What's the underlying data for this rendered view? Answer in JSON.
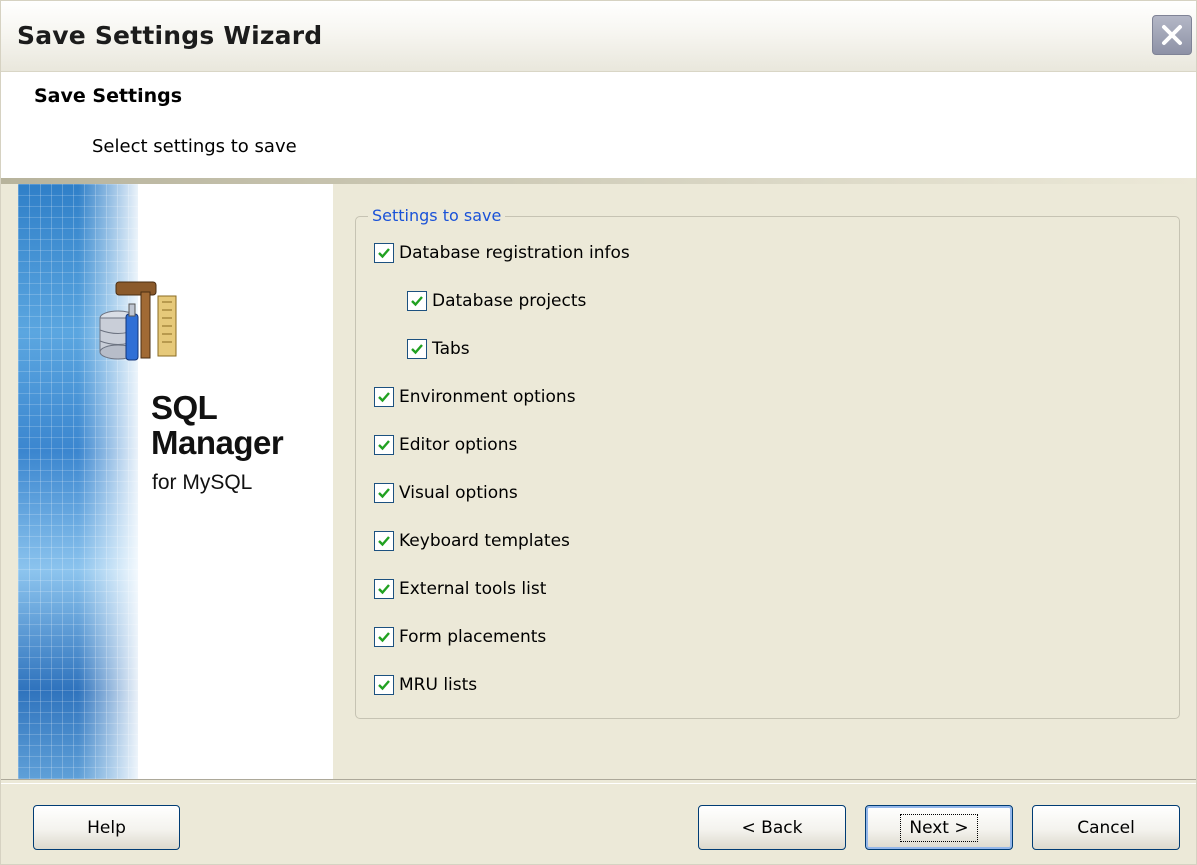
{
  "window": {
    "title": "Save Settings Wizard"
  },
  "header": {
    "title": "Save Settings",
    "subtitle": "Select settings to save"
  },
  "banner": {
    "product_line1": "SQL",
    "product_line2": "Manager",
    "product_line3": "for MySQL"
  },
  "group": {
    "legend": "Settings to save",
    "items": [
      {
        "label": "Database registration infos",
        "checked": true,
        "indent": 0
      },
      {
        "label": "Database projects",
        "checked": true,
        "indent": 1
      },
      {
        "label": "Tabs",
        "checked": true,
        "indent": 1
      },
      {
        "label": "Environment options",
        "checked": true,
        "indent": 0
      },
      {
        "label": "Editor options",
        "checked": true,
        "indent": 0
      },
      {
        "label": "Visual options",
        "checked": true,
        "indent": 0
      },
      {
        "label": "Keyboard templates",
        "checked": true,
        "indent": 0
      },
      {
        "label": "External tools list",
        "checked": true,
        "indent": 0
      },
      {
        "label": "Form placements",
        "checked": true,
        "indent": 0
      },
      {
        "label": "MRU lists",
        "checked": true,
        "indent": 0
      }
    ]
  },
  "buttons": {
    "help": "Help",
    "back": "< Back",
    "next": "Next >",
    "cancel": "Cancel"
  },
  "colors": {
    "accent_blue": "#1a52d8",
    "window_face": "#ece9d8",
    "button_border": "#003c74"
  },
  "icons": {
    "close": "close-icon",
    "check": "check-icon",
    "product": "database-tools-icon"
  }
}
